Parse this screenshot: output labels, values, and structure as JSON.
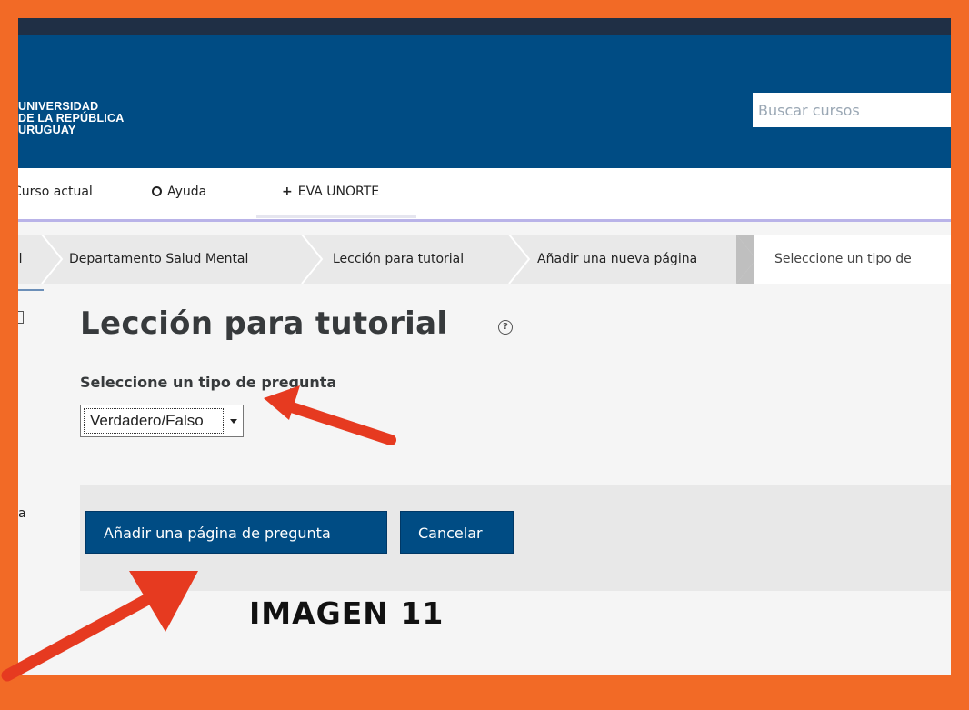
{
  "header": {
    "logo_lines": [
      "UNIVERSIDAD",
      "DE LA REPÚBLICA",
      "URUGUAY"
    ],
    "search_placeholder": "Buscar cursos"
  },
  "nav": {
    "items": [
      {
        "label": "Curso actual",
        "icon": "none"
      },
      {
        "label": "Ayuda",
        "icon": "lifebuoy-icon"
      },
      {
        "label": "EVA UNORTE",
        "icon": "plus-icon"
      }
    ]
  },
  "breadcrumb": {
    "items": [
      "al",
      "Departamento Salud Mental",
      "Lección para tutorial",
      "Añadir una nueva página",
      "Seleccione un tipo de"
    ]
  },
  "sidebar_fragment": "a",
  "main": {
    "title": "Lección para tutorial",
    "help_icon": "?",
    "select_label": "Seleccione un tipo de pregunta",
    "select_value": "Verdadero/Falso"
  },
  "buttons": {
    "add": "Añadir una página de pregunta",
    "cancel": "Cancelar"
  },
  "caption": "IMAGEN 11",
  "colors": {
    "frame": "#f26a26",
    "header": "#004c84",
    "button": "#004c84",
    "arrow": "#e63a20"
  }
}
